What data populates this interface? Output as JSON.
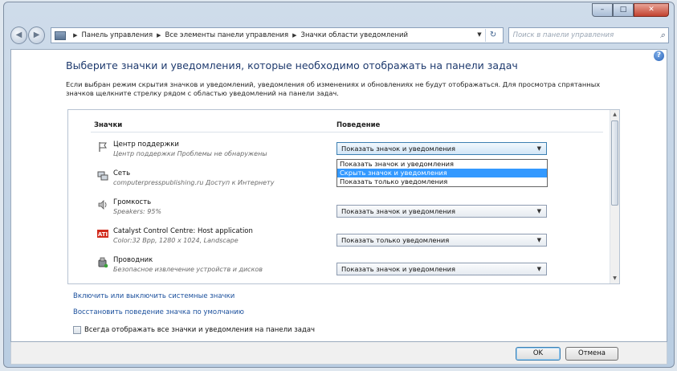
{
  "window": {
    "minimize": "–",
    "maximize": "□",
    "close": "✕"
  },
  "nav": {
    "breadcrumbs": [
      "Панель управления",
      "Все элементы панели управления",
      "Значки области уведомлений"
    ],
    "search_placeholder": "Поиск в панели управления"
  },
  "page": {
    "title": "Выберите значки и уведомления, которые необходимо отображать на панели задач",
    "description": "Если выбран режим скрытия значков и уведомлений, уведомления об изменениях и обновлениях не будут отображаться. Для просмотра спрятанных значков щелкните стрелку рядом с областью уведомлений на панели задач."
  },
  "table": {
    "col_icons": "Значки",
    "col_behavior": "Поведение",
    "rows": [
      {
        "name": "Центр поддержки",
        "desc": "Центр поддержки  Проблемы не обнаружены",
        "behavior": "Показать значок и уведомления",
        "icon": "flag-icon"
      },
      {
        "name": "Сеть",
        "desc": "computerpresspublishing.ru Доступ к Интернету",
        "behavior": "",
        "icon": "network-icon"
      },
      {
        "name": "Громкость",
        "desc": "Speakers: 95%",
        "behavior": "Показать значок и уведомления",
        "icon": "speaker-icon"
      },
      {
        "name": "Catalyst Control Centre: Host application",
        "desc": "Color:32 Bpp, 1280 x 1024, Landscape",
        "behavior": "Показать только уведомления",
        "icon": "ati-icon"
      },
      {
        "name": "Проводник",
        "desc": "Безопасное извлечение устройств и дисков",
        "behavior": "Показать значок и уведомления",
        "icon": "usb-device-icon"
      }
    ],
    "dropdown_options": [
      "Показать значок и уведомления",
      "Скрыть значок и уведомления",
      "Показать только уведомления"
    ],
    "dropdown_highlighted": 1
  },
  "links": {
    "system_icons": "Включить или выключить системные значки",
    "restore_defaults": "Восстановить поведение значка по умолчанию"
  },
  "always_show": {
    "label": "Всегда отображать все значки и уведомления на панели задач",
    "checked": false
  },
  "buttons": {
    "ok": "OK",
    "cancel": "Отмена"
  }
}
